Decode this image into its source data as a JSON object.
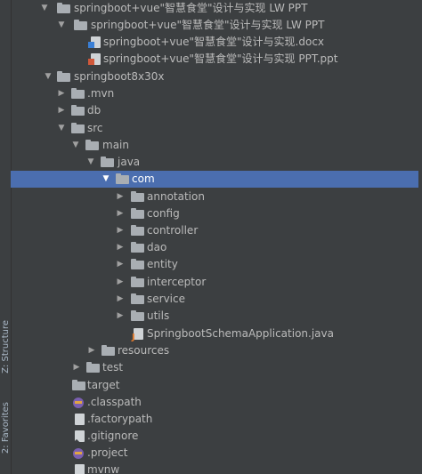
{
  "side_tabs": {
    "structure": "Z: Structure",
    "favorites": "2: Favorites"
  },
  "tree": [
    {
      "label": "springboot+vue\"智慧食堂\"设计与实现 LW PPT",
      "arrow": "▼",
      "icon": "folder"
    },
    {
      "label": "springboot+vue\"智慧食堂\"设计与实现 LW PPT",
      "arrow": "▼",
      "icon": "folder"
    },
    {
      "label": "springboot+vue\"智慧食堂\"设计与实现.docx",
      "arrow": "",
      "icon": "word-file"
    },
    {
      "label": "springboot+vue\"智慧食堂\"设计与实现 PPT.ppt",
      "arrow": "",
      "icon": "ppt-file"
    },
    {
      "label": "springboot8x30x",
      "arrow": "▼",
      "icon": "folder"
    },
    {
      "label": ".mvn",
      "arrow": "▶",
      "icon": "folder"
    },
    {
      "label": "db",
      "arrow": "▶",
      "icon": "folder"
    },
    {
      "label": "src",
      "arrow": "▼",
      "icon": "folder"
    },
    {
      "label": "main",
      "arrow": "▼",
      "icon": "folder"
    },
    {
      "label": "java",
      "arrow": "▼",
      "icon": "folder"
    },
    {
      "label": "com",
      "arrow": "▼",
      "icon": "folder",
      "selected": true
    },
    {
      "label": "annotation",
      "arrow": "▶",
      "icon": "folder"
    },
    {
      "label": "config",
      "arrow": "▶",
      "icon": "folder"
    },
    {
      "label": "controller",
      "arrow": "▶",
      "icon": "folder"
    },
    {
      "label": "dao",
      "arrow": "▶",
      "icon": "folder"
    },
    {
      "label": "entity",
      "arrow": "▶",
      "icon": "folder"
    },
    {
      "label": "interceptor",
      "arrow": "▶",
      "icon": "folder"
    },
    {
      "label": "service",
      "arrow": "▶",
      "icon": "folder"
    },
    {
      "label": "utils",
      "arrow": "▶",
      "icon": "folder"
    },
    {
      "label": "SpringbootSchemaApplication.java",
      "arrow": "",
      "icon": "java-class-file"
    },
    {
      "label": "resources",
      "arrow": "▶",
      "icon": "folder"
    },
    {
      "label": "test",
      "arrow": "▶",
      "icon": "folder"
    },
    {
      "label": "target",
      "arrow": "",
      "icon": "folder"
    },
    {
      "label": ".classpath",
      "arrow": "",
      "icon": "config-file"
    },
    {
      "label": ".factorypath",
      "arrow": "",
      "icon": "file"
    },
    {
      "label": ".gitignore",
      "arrow": "",
      "icon": "git-file"
    },
    {
      "label": ".project",
      "arrow": "",
      "icon": "config-file"
    },
    {
      "label": "mvnw",
      "arrow": "",
      "icon": "file"
    }
  ]
}
